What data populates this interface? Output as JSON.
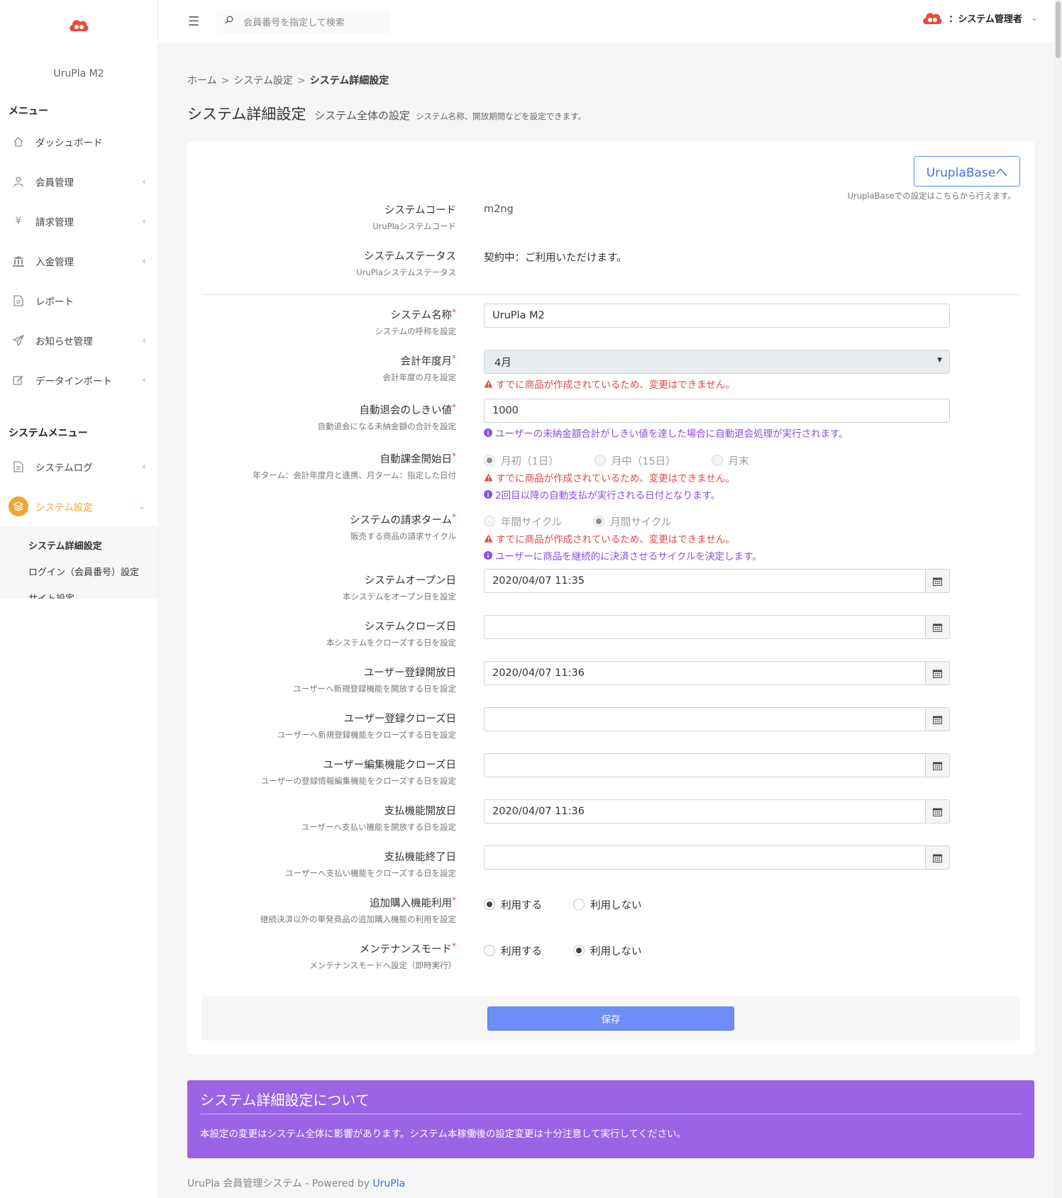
{
  "app_name": "UruPla M2",
  "topbar": {
    "search_placeholder": "会員番号を指定して検索",
    "user_label": "：システム管理者"
  },
  "sidebar": {
    "menu_heading": "メニュー",
    "items": [
      {
        "label": "ダッシュボード",
        "icon": "home-icon",
        "chevron": false
      },
      {
        "label": "会員管理",
        "icon": "user-icon",
        "chevron": true
      },
      {
        "label": "請求管理",
        "icon": "yen-icon",
        "chevron": true
      },
      {
        "label": "入金管理",
        "icon": "bank-icon",
        "chevron": true
      },
      {
        "label": "レポート",
        "icon": "document-icon",
        "chevron": false
      },
      {
        "label": "お知らせ管理",
        "icon": "send-icon",
        "chevron": true
      },
      {
        "label": "データインポート",
        "icon": "edit-icon",
        "chevron": true
      }
    ],
    "system_heading": "システムメニュー",
    "system_items": [
      {
        "label": "システムログ",
        "icon": "document-icon",
        "chevron": true
      },
      {
        "label": "システム設定",
        "icon": "layers-icon",
        "active": true
      }
    ],
    "submenu": [
      {
        "label": "システム詳細設定",
        "current": true
      },
      {
        "label": "ログイン（会員番号）設定"
      },
      {
        "label": "サイト設定"
      }
    ]
  },
  "breadcrumb": {
    "home": "ホーム",
    "sep": ">",
    "parent": "システム設定",
    "current": "システム詳細設定"
  },
  "page": {
    "title": "システム詳細設定",
    "subtitle": "システム全体の設定",
    "description": "システム名称、開放期間などを設定できます。"
  },
  "card": {
    "base_button": "UruplaBaseへ",
    "base_note": "UruplaBaseでの設定はこちらから行えます。",
    "required_mark": "*",
    "fields": {
      "system_code": {
        "label": "システムコード",
        "sub": "UruPlaシステムコード",
        "value": "m2ng"
      },
      "system_status": {
        "label": "システムステータス",
        "sub": "UruPlaシステムステータス",
        "value": "契約中：ご利用いただけます。"
      },
      "system_name": {
        "label": "システム名称",
        "sub": "システムの呼称を設定",
        "value": "UruPla M2"
      },
      "fiscal_month": {
        "label": "会計年度月",
        "sub": "会計年度の月を設定",
        "value": "4月",
        "error": "すでに商品が作成されているため、変更はできません。"
      },
      "auto_withdraw": {
        "label": "自動退会のしきい値",
        "sub": "自動退会になる未納金額の合計を設定",
        "value": "1000",
        "info": "ユーザーの未納金額合計がしきい値を達した場合に自動退会処理が実行されます。"
      },
      "billing_start": {
        "label": "自動課金開始日",
        "sub": "年ターム：会計年度月と連携、月ターム：指定した日付",
        "options": [
          "月初（1日）",
          "月中（15日）",
          "月末"
        ],
        "selected": 0,
        "error": "すでに商品が作成されているため、変更はできません。",
        "info": "2回目以降の自動支払が実行される日付となります。"
      },
      "billing_term": {
        "label": "システムの請求ターム",
        "sub": "販売する商品の請求サイクル",
        "options": [
          "年間サイクル",
          "月間サイクル"
        ],
        "selected": 1,
        "error": "すでに商品が作成されているため、変更はできません。",
        "info": "ユーザーに商品を継続的に決済させるサイクルを決定します。"
      },
      "open_date": {
        "label": "システムオープン日",
        "sub": "本システムをオープン日を設定",
        "value": "2020/04/07 11:35"
      },
      "close_date": {
        "label": "システムクローズ日",
        "sub": "本システムをクローズする日を設定",
        "value": ""
      },
      "reg_open": {
        "label": "ユーザー登録開放日",
        "sub": "ユーザーへ新規登録機能を開放する日を設定",
        "value": "2020/04/07 11:36"
      },
      "reg_close": {
        "label": "ユーザー登録クローズ日",
        "sub": "ユーザーへ新規登録機能をクローズする日を設定",
        "value": ""
      },
      "edit_close": {
        "label": "ユーザー編集機能クローズ日",
        "sub": "ユーザーの登録情報編集機能をクローズする日を設定",
        "value": ""
      },
      "pay_open": {
        "label": "支払機能開放日",
        "sub": "ユーザーへ支払い機能を開放する日を設定",
        "value": "2020/04/07 11:36"
      },
      "pay_end": {
        "label": "支払機能終了日",
        "sub": "ユーザーへ支払い機能をクローズする日を設定",
        "value": ""
      },
      "extra_purchase": {
        "label": "追加購入機能利用",
        "sub": "継続決済以外の単発商品の追加購入機能の利用を設定",
        "options": [
          "利用する",
          "利用しない"
        ],
        "selected": 0
      },
      "maintenance": {
        "label": "メンテナンスモード",
        "sub": "メンテナンスモードへ設定（即時実行）",
        "options": [
          "利用する",
          "利用しない"
        ],
        "selected": 1
      }
    },
    "save_button": "保存"
  },
  "notice": {
    "title": "システム詳細設定について",
    "body": "本設定の変更はシステム全体に影響があります。システム本稼働後の設定変更は十分注意して実行してください。"
  },
  "footer": {
    "text": "UruPla 会員管理システム - Powered by ",
    "link": "UruPla"
  },
  "colors": {
    "accent": "#f4a52e",
    "primary": "#6d8ef7",
    "error": "#e5484d",
    "info": "#8c4fe0",
    "notice_bg": "#9b63e6"
  }
}
